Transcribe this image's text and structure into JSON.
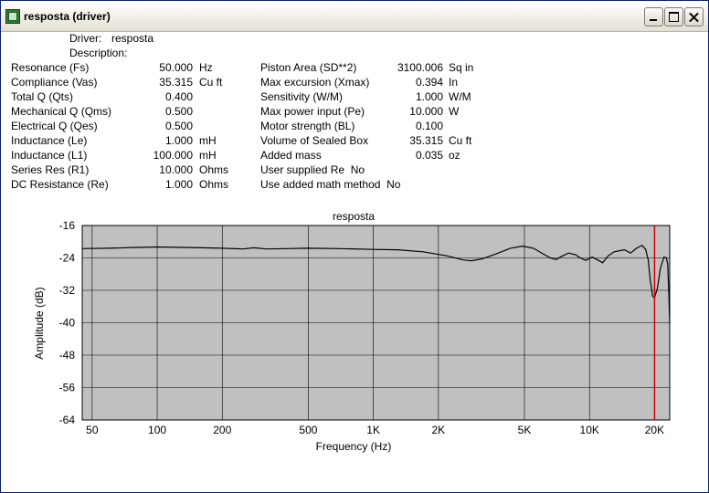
{
  "window": {
    "title": "resposta (driver)",
    "buttons": {
      "minimize": "minimize-icon",
      "maximize": "maximize-icon",
      "close": "close-icon"
    }
  },
  "header": {
    "driver_label": "Driver:",
    "driver_value": "resposta",
    "description_label": "Description:"
  },
  "params_left": [
    {
      "label": "Resonance (Fs)",
      "value": "50.000",
      "unit": "Hz"
    },
    {
      "label": "Compliance (Vas)",
      "value": "35.315",
      "unit": "Cu ft"
    },
    {
      "label": "Total Q (Qts)",
      "value": "0.400",
      "unit": ""
    },
    {
      "label": "Mechanical Q (Qms)",
      "value": "0.500",
      "unit": ""
    },
    {
      "label": "Electrical Q (Qes)",
      "value": "0.500",
      "unit": ""
    },
    {
      "label": "Inductance (Le)",
      "value": "1.000",
      "unit": "mH"
    },
    {
      "label": "Inductance (L1)",
      "value": "100.000",
      "unit": "mH"
    },
    {
      "label": "Series Res (R1)",
      "value": "10.000",
      "unit": "Ohms"
    },
    {
      "label": "DC Resistance (Re)",
      "value": "1.000",
      "unit": "Ohms"
    }
  ],
  "params_right": [
    {
      "label": "Piston Area (SD**2)",
      "value": "3100.006",
      "unit": "Sq in"
    },
    {
      "label": "Max excursion (Xmax)",
      "value": "0.394",
      "unit": "In"
    },
    {
      "label": "Sensitivity (W/M)",
      "value": "1.000",
      "unit": "W/M"
    },
    {
      "label": "Max power input (Pe)",
      "value": "10.000",
      "unit": "W"
    },
    {
      "label": "Motor strength (BL)",
      "value": "0.100",
      "unit": ""
    },
    {
      "label": "Volume of Sealed Box",
      "value": "35.315",
      "unit": "Cu ft"
    },
    {
      "label": "Added mass",
      "value": "0.035",
      "unit": "oz"
    }
  ],
  "params_flags": [
    {
      "label": "User supplied Re",
      "value": "No"
    },
    {
      "label": "Use added math method",
      "value": "No"
    }
  ],
  "chart_data": {
    "type": "line",
    "title": "resposta",
    "xlabel": "Frequency (Hz)",
    "ylabel": "Amplitude (dB)",
    "xscale": "log",
    "xlim": [
      45,
      23500
    ],
    "ylim": [
      -64,
      -16
    ],
    "xticks": [
      50,
      100,
      200,
      500,
      1000,
      2000,
      5000,
      10000,
      20000
    ],
    "xtick_labels": [
      "50",
      "100",
      "200",
      "500",
      "1K",
      "2K",
      "5K",
      "10K",
      "20K"
    ],
    "yticks": [
      -16,
      -24,
      -32,
      -40,
      -48,
      -56,
      -64
    ],
    "ytick_labels": [
      "-16",
      "-24",
      "-32",
      "-40",
      "-48",
      "-56",
      "-64"
    ],
    "grid": true,
    "plot_background": "#c0c0c0",
    "line_color": "#000000",
    "marker_color": "#cc0000",
    "marker_x": 20000,
    "series": [
      {
        "x": [
          45,
          60,
          80,
          100,
          130,
          160,
          200,
          250,
          280,
          320,
          400,
          500,
          700,
          1000,
          1300,
          1700,
          2200,
          2600,
          2850,
          3200,
          3700,
          4300,
          4900,
          5500,
          6100,
          6600,
          7000,
          7500,
          8000,
          8600,
          9000,
          9600,
          10300,
          10900,
          11500,
          12200,
          13000,
          14500,
          15500,
          16500,
          17500,
          18200,
          18700,
          19100,
          19600,
          20000,
          20600,
          21300,
          22100,
          22700,
          23000,
          23300,
          23500
        ],
        "y": [
          -21.7,
          -21.6,
          -21.4,
          -21.3,
          -21.4,
          -21.5,
          -21.6,
          -21.8,
          -21.5,
          -21.8,
          -21.7,
          -21.6,
          -21.7,
          -21.9,
          -22.0,
          -22.5,
          -23.5,
          -24.5,
          -24.7,
          -24.2,
          -23.0,
          -21.6,
          -21.1,
          -21.6,
          -23.0,
          -24.0,
          -24.4,
          -23.5,
          -22.8,
          -23.2,
          -23.9,
          -24.6,
          -23.8,
          -24.5,
          -25.2,
          -23.5,
          -22.5,
          -22.0,
          -22.8,
          -21.6,
          -20.9,
          -21.9,
          -24.5,
          -29.5,
          -33.5,
          -33.8,
          -31.5,
          -26.5,
          -23.8,
          -24.0,
          -25.5,
          -33.0,
          -40.5
        ]
      }
    ]
  }
}
